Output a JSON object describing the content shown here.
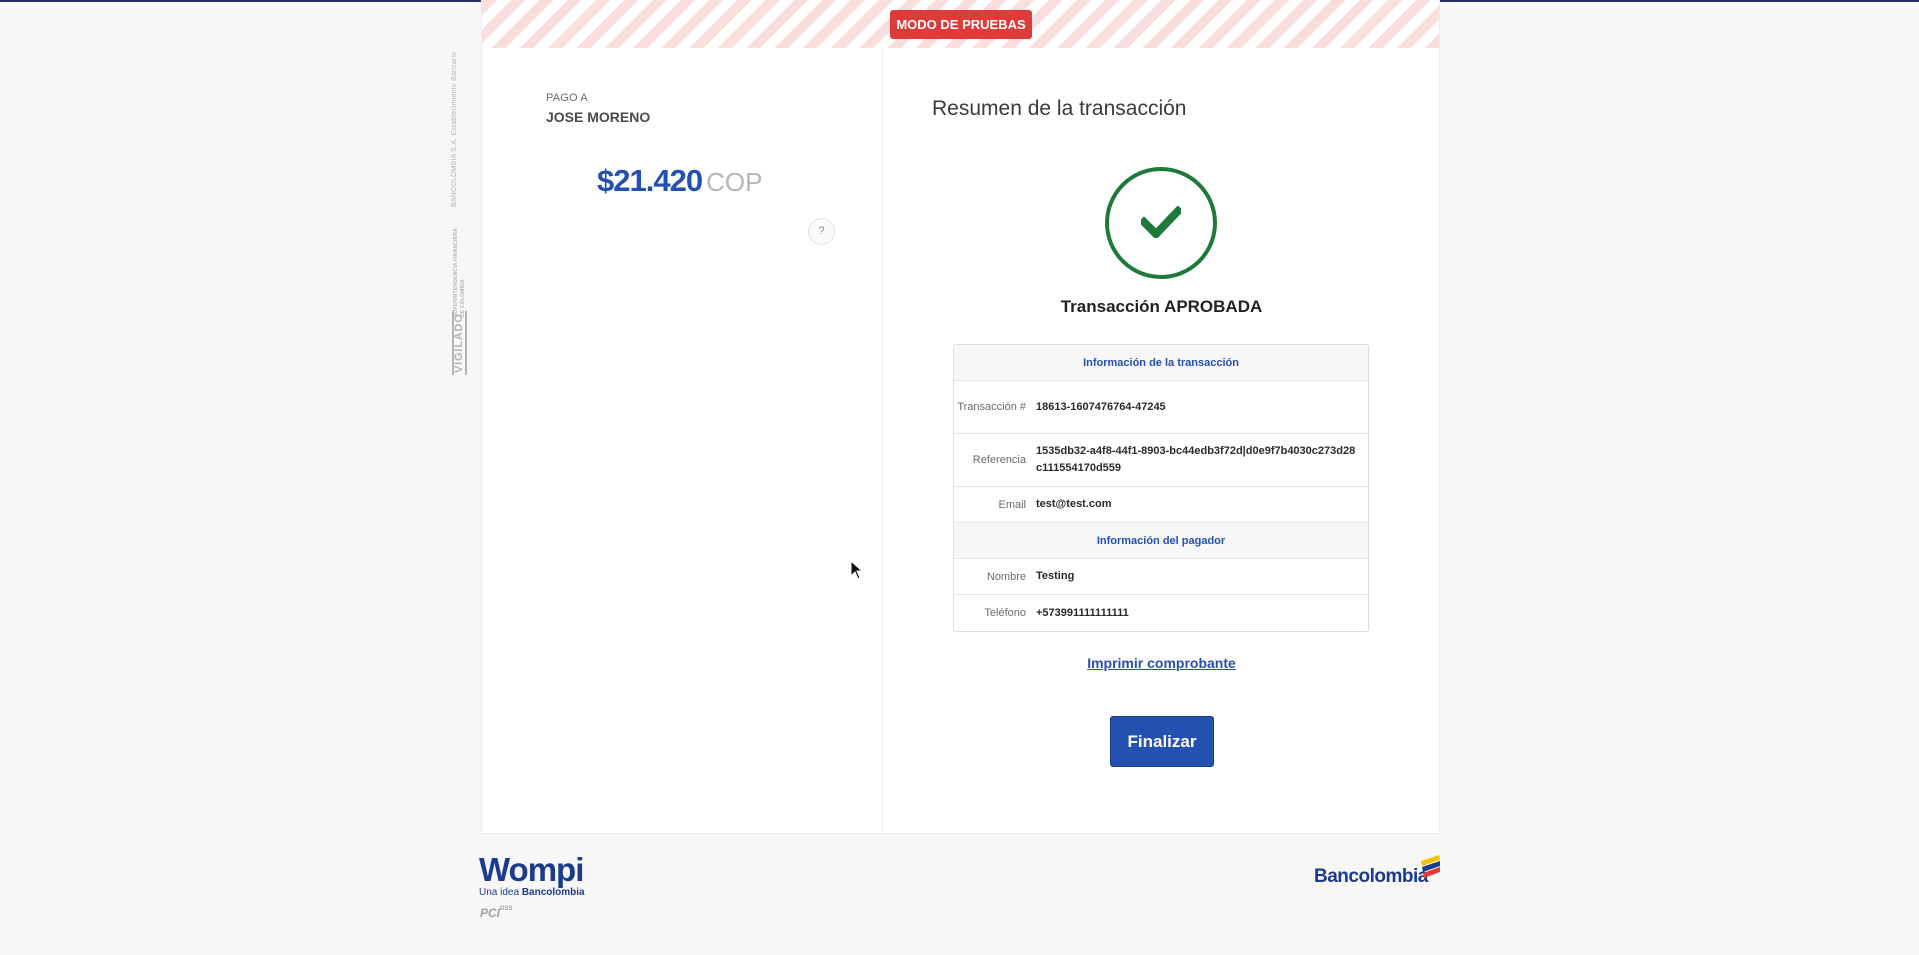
{
  "banner": {
    "test_mode": "MODO DE PRUEBAS"
  },
  "vigilado": {
    "small": "BANCOLOMBIA S.A. Establecimiento Bancario",
    "mid_line1": "SUPERINTENDENCIA FINANCIERA",
    "mid_line2": "DE COLOMBIA",
    "big": "VIGILADO"
  },
  "payment": {
    "pay_to_label": "PAGO A",
    "merchant": "JOSE MORENO",
    "amount": "$21.420",
    "currency": "COP",
    "help": "?"
  },
  "summary": {
    "title": "Resumen de la transacción",
    "status": "Transacción APROBADA",
    "transaction_section": "Información de la transacción",
    "rows": [
      {
        "label": "Transacción #",
        "value": "18613-1607476764-47245"
      },
      {
        "label": "Referencia",
        "value": "1535db32-a4f8-44f1-8903-bc44edb3f72d|d0e9f7b4030c273d28c111554170d559"
      },
      {
        "label": "Email",
        "value": "test@test.com"
      }
    ],
    "payer_section": "Información del pagador",
    "payer_rows": [
      {
        "label": "Nombre",
        "value": "Testing"
      },
      {
        "label": "Teléfono",
        "value": "+573991111111111"
      }
    ],
    "print_link": "Imprimir comprobante",
    "finish_button": "Finalizar"
  },
  "footer": {
    "wompi": "Wompi",
    "tagline_prefix": "Una idea",
    "tagline_brand": "Bancolombia",
    "pci": "PCI",
    "dss": "DSS",
    "bank": "Bancolombia"
  },
  "colors": {
    "primary": "#2450b0",
    "success": "#1e7a3a",
    "test_badge": "#e03b3b"
  }
}
